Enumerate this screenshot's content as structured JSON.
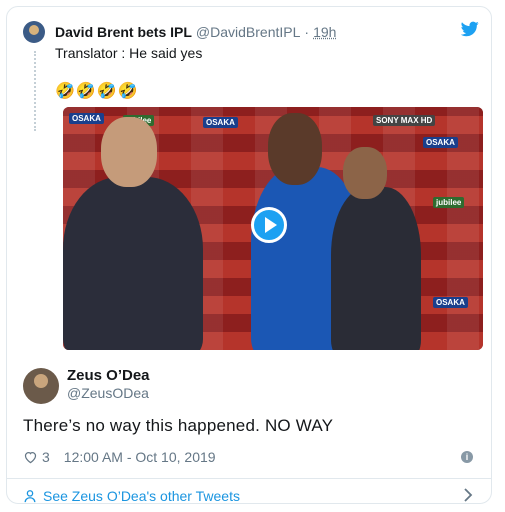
{
  "quoted_tweet": {
    "author_name": "David Brent bets IPL",
    "author_handle": "@DavidBrentIPL",
    "separator": "·",
    "time_ago": "19h",
    "text": "Translator : He said yes",
    "emojis": "🤣🤣🤣🤣"
  },
  "main_tweet": {
    "author_name": "Zeus O’Dea",
    "author_handle": "@ZeusODea",
    "text": "There’s no way this happened. NO WAY",
    "like_count": "3",
    "timestamp": "12:00 AM - Oct 10, 2019"
  },
  "footer": {
    "see_more": "See Zeus O’Dea's other Tweets"
  },
  "colors": {
    "twitter_blue": "#1da1f2",
    "link_blue": "#1b95e0",
    "muted": "#657786"
  },
  "icons": [
    "twitter-bird-icon",
    "play-icon",
    "heart-icon",
    "info-icon",
    "person-icon",
    "chevron-right-icon"
  ]
}
